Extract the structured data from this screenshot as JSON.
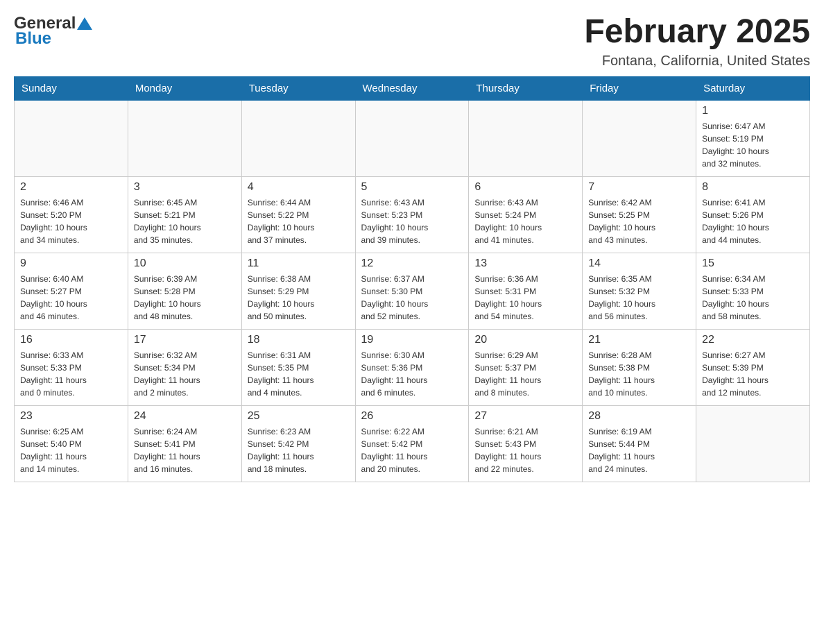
{
  "header": {
    "logo_general": "General",
    "logo_blue": "Blue",
    "title": "February 2025",
    "subtitle": "Fontana, California, United States"
  },
  "weekdays": [
    "Sunday",
    "Monday",
    "Tuesday",
    "Wednesday",
    "Thursday",
    "Friday",
    "Saturday"
  ],
  "weeks": [
    [
      {
        "day": "",
        "info": ""
      },
      {
        "day": "",
        "info": ""
      },
      {
        "day": "",
        "info": ""
      },
      {
        "day": "",
        "info": ""
      },
      {
        "day": "",
        "info": ""
      },
      {
        "day": "",
        "info": ""
      },
      {
        "day": "1",
        "info": "Sunrise: 6:47 AM\nSunset: 5:19 PM\nDaylight: 10 hours\nand 32 minutes."
      }
    ],
    [
      {
        "day": "2",
        "info": "Sunrise: 6:46 AM\nSunset: 5:20 PM\nDaylight: 10 hours\nand 34 minutes."
      },
      {
        "day": "3",
        "info": "Sunrise: 6:45 AM\nSunset: 5:21 PM\nDaylight: 10 hours\nand 35 minutes."
      },
      {
        "day": "4",
        "info": "Sunrise: 6:44 AM\nSunset: 5:22 PM\nDaylight: 10 hours\nand 37 minutes."
      },
      {
        "day": "5",
        "info": "Sunrise: 6:43 AM\nSunset: 5:23 PM\nDaylight: 10 hours\nand 39 minutes."
      },
      {
        "day": "6",
        "info": "Sunrise: 6:43 AM\nSunset: 5:24 PM\nDaylight: 10 hours\nand 41 minutes."
      },
      {
        "day": "7",
        "info": "Sunrise: 6:42 AM\nSunset: 5:25 PM\nDaylight: 10 hours\nand 43 minutes."
      },
      {
        "day": "8",
        "info": "Sunrise: 6:41 AM\nSunset: 5:26 PM\nDaylight: 10 hours\nand 44 minutes."
      }
    ],
    [
      {
        "day": "9",
        "info": "Sunrise: 6:40 AM\nSunset: 5:27 PM\nDaylight: 10 hours\nand 46 minutes."
      },
      {
        "day": "10",
        "info": "Sunrise: 6:39 AM\nSunset: 5:28 PM\nDaylight: 10 hours\nand 48 minutes."
      },
      {
        "day": "11",
        "info": "Sunrise: 6:38 AM\nSunset: 5:29 PM\nDaylight: 10 hours\nand 50 minutes."
      },
      {
        "day": "12",
        "info": "Sunrise: 6:37 AM\nSunset: 5:30 PM\nDaylight: 10 hours\nand 52 minutes."
      },
      {
        "day": "13",
        "info": "Sunrise: 6:36 AM\nSunset: 5:31 PM\nDaylight: 10 hours\nand 54 minutes."
      },
      {
        "day": "14",
        "info": "Sunrise: 6:35 AM\nSunset: 5:32 PM\nDaylight: 10 hours\nand 56 minutes."
      },
      {
        "day": "15",
        "info": "Sunrise: 6:34 AM\nSunset: 5:33 PM\nDaylight: 10 hours\nand 58 minutes."
      }
    ],
    [
      {
        "day": "16",
        "info": "Sunrise: 6:33 AM\nSunset: 5:33 PM\nDaylight: 11 hours\nand 0 minutes."
      },
      {
        "day": "17",
        "info": "Sunrise: 6:32 AM\nSunset: 5:34 PM\nDaylight: 11 hours\nand 2 minutes."
      },
      {
        "day": "18",
        "info": "Sunrise: 6:31 AM\nSunset: 5:35 PM\nDaylight: 11 hours\nand 4 minutes."
      },
      {
        "day": "19",
        "info": "Sunrise: 6:30 AM\nSunset: 5:36 PM\nDaylight: 11 hours\nand 6 minutes."
      },
      {
        "day": "20",
        "info": "Sunrise: 6:29 AM\nSunset: 5:37 PM\nDaylight: 11 hours\nand 8 minutes."
      },
      {
        "day": "21",
        "info": "Sunrise: 6:28 AM\nSunset: 5:38 PM\nDaylight: 11 hours\nand 10 minutes."
      },
      {
        "day": "22",
        "info": "Sunrise: 6:27 AM\nSunset: 5:39 PM\nDaylight: 11 hours\nand 12 minutes."
      }
    ],
    [
      {
        "day": "23",
        "info": "Sunrise: 6:25 AM\nSunset: 5:40 PM\nDaylight: 11 hours\nand 14 minutes."
      },
      {
        "day": "24",
        "info": "Sunrise: 6:24 AM\nSunset: 5:41 PM\nDaylight: 11 hours\nand 16 minutes."
      },
      {
        "day": "25",
        "info": "Sunrise: 6:23 AM\nSunset: 5:42 PM\nDaylight: 11 hours\nand 18 minutes."
      },
      {
        "day": "26",
        "info": "Sunrise: 6:22 AM\nSunset: 5:42 PM\nDaylight: 11 hours\nand 20 minutes."
      },
      {
        "day": "27",
        "info": "Sunrise: 6:21 AM\nSunset: 5:43 PM\nDaylight: 11 hours\nand 22 minutes."
      },
      {
        "day": "28",
        "info": "Sunrise: 6:19 AM\nSunset: 5:44 PM\nDaylight: 11 hours\nand 24 minutes."
      },
      {
        "day": "",
        "info": ""
      }
    ]
  ]
}
